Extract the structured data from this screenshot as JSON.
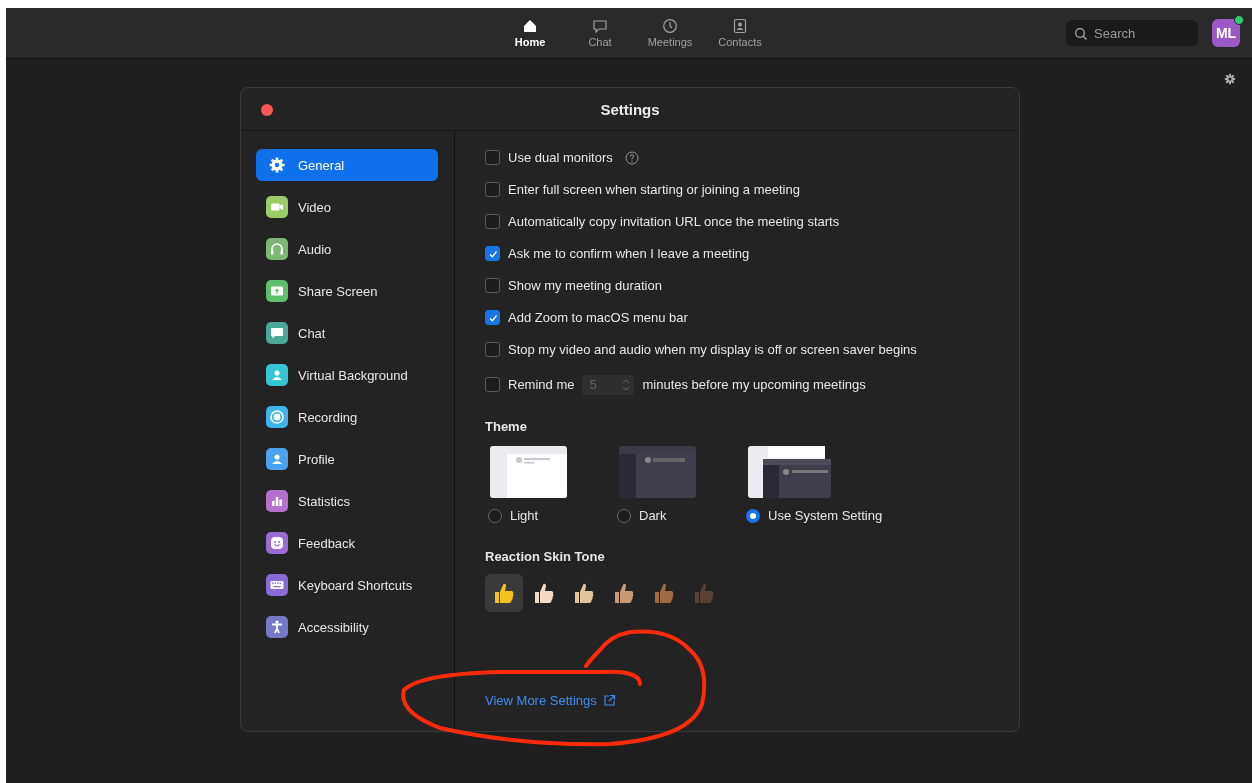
{
  "top_bar": {
    "nav": [
      {
        "kind": "home",
        "label": "Home",
        "selected": true
      },
      {
        "kind": "chat",
        "label": "Chat",
        "selected": false
      },
      {
        "kind": "clock",
        "label": "Meetings",
        "selected": false
      },
      {
        "kind": "contacts",
        "label": "Contacts",
        "selected": false
      }
    ],
    "search": {
      "placeholder": "Search"
    },
    "avatar": {
      "initials": "ML",
      "online": true
    }
  },
  "window": {
    "title": "Settings"
  },
  "sidebar": {
    "items": [
      {
        "kind": "gear",
        "label": "General",
        "color": "#0e71eb",
        "selected": true
      },
      {
        "kind": "video",
        "label": "Video",
        "color": "#9ccc65",
        "selected": false
      },
      {
        "kind": "headphones",
        "label": "Audio",
        "color": "#7cb874",
        "selected": false
      },
      {
        "kind": "share",
        "label": "Share Screen",
        "color": "#5fbf6a",
        "selected": false
      },
      {
        "kind": "chat",
        "label": "Chat",
        "color": "#4aa898",
        "selected": false
      },
      {
        "kind": "person",
        "label": "Virtual Background",
        "color": "#35c5d5",
        "selected": false
      },
      {
        "kind": "record",
        "label": "Recording",
        "color": "#3cb4ec",
        "selected": false
      },
      {
        "kind": "person",
        "label": "Profile",
        "color": "#4aa3f0",
        "selected": false
      },
      {
        "kind": "bars",
        "label": "Statistics",
        "color": "#b56fce",
        "selected": false
      },
      {
        "kind": "smile",
        "label": "Feedback",
        "color": "#9a6ad6",
        "selected": false
      },
      {
        "kind": "keyboard",
        "label": "Keyboard Shortcuts",
        "color": "#8a6ad8",
        "selected": false
      },
      {
        "kind": "accessibility",
        "label": "Accessibility",
        "color": "#7678c8",
        "selected": false
      }
    ]
  },
  "options": [
    {
      "kind": "checkbox",
      "label": "Use dual monitors",
      "checked": false,
      "help": true
    },
    {
      "kind": "checkbox",
      "label": "Enter full screen when starting or joining a meeting",
      "checked": false
    },
    {
      "kind": "checkbox",
      "label": "Automatically copy invitation URL once the meeting starts",
      "checked": false
    },
    {
      "kind": "checkbox",
      "label": "Ask me to confirm when I leave a meeting",
      "checked": true
    },
    {
      "kind": "checkbox",
      "label": "Show my meeting duration",
      "checked": false
    },
    {
      "kind": "checkbox",
      "label": "Add Zoom to macOS menu bar",
      "checked": true
    },
    {
      "kind": "checkbox",
      "label": "Stop my video and audio when my display is off or screen saver begins",
      "checked": false
    },
    {
      "kind": "stepper",
      "label": "Remind me",
      "value": "5",
      "after": "minutes before my upcoming meetings",
      "checked": false
    }
  ],
  "theme": {
    "heading": "Theme",
    "options": [
      {
        "kind": "light",
        "label": "Light",
        "selected": false
      },
      {
        "kind": "dark",
        "label": "Dark",
        "selected": false
      },
      {
        "kind": "system",
        "label": "Use System Setting",
        "selected": true
      }
    ]
  },
  "skin_tone": {
    "heading": "Reaction Skin Tone",
    "tones": [
      {
        "color": "#f7c21c",
        "selected": true
      },
      {
        "color": "#f3dac4",
        "selected": false
      },
      {
        "color": "#e3c39a",
        "selected": false
      },
      {
        "color": "#c79a73",
        "selected": false
      },
      {
        "color": "#a06a42",
        "selected": false
      },
      {
        "color": "#5a4135",
        "selected": false
      }
    ]
  },
  "link": "View More Settings",
  "annotation": {
    "kind": "circle",
    "color": "#ff2a0a"
  }
}
